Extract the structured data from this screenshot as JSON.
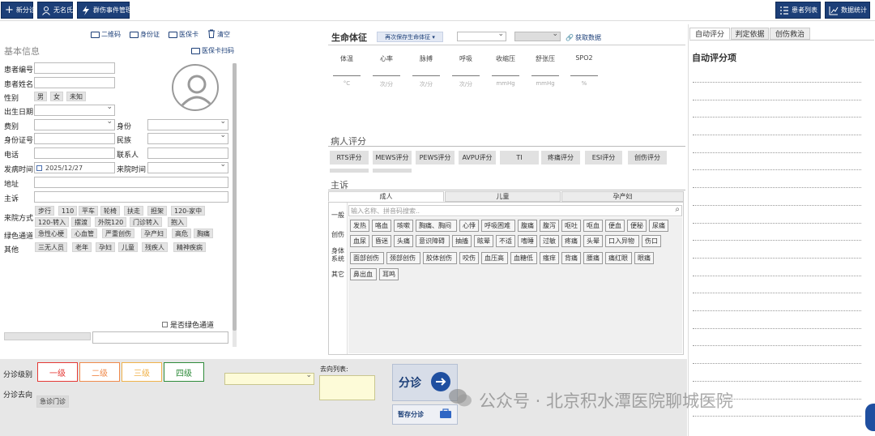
{
  "toolbar": {
    "new_triage": "新分诊",
    "anonymous": "无名氏",
    "mass_casualty": "群伤事件管理",
    "patient_list": "患者列表",
    "statistics": "数据统计"
  },
  "left": {
    "qr_code": "二维码",
    "id_card": "身份证",
    "insurance_card": "医保卡",
    "clear": "清空",
    "section_title": "基本信息",
    "insurance_scan": "医保卡扫码",
    "patient_no": "患者编号",
    "patient_name": "患者姓名",
    "gender_label": "性别",
    "gender_options": [
      "男",
      "女",
      "未知"
    ],
    "dob": "出生日期",
    "fee_type": "费别",
    "identity": "身份",
    "id_number": "身份证号",
    "ethnicity": "民族",
    "phone": "电话",
    "contact": "联系人",
    "onset_time": "发病时间",
    "onset_value": "2025/12/27",
    "arrival_time": "来院时间",
    "address": "地址",
    "complaint": "主诉",
    "arrival_mode": "来院方式",
    "arrival_options": [
      "步行",
      "110",
      "平车",
      "轮椅",
      "扶走",
      "担架",
      "120-家中",
      "120-转入",
      "摆渡",
      "外院120",
      "门诊转入",
      "抱入"
    ],
    "green_channel": "绿色通道",
    "green_options": [
      "急性心梗",
      "心血管",
      "严重创伤",
      "孕产妇",
      "高危",
      "胸痛"
    ],
    "other": "其他",
    "other_options": [
      "三无人员",
      "老年",
      "孕妇",
      "儿童",
      "残疾人",
      "精神疾病"
    ],
    "is_green_channel": "是否绿色通道"
  },
  "vitals": {
    "title": "生命体征",
    "resave": "再次保存生命体征",
    "fetch": "获取数据",
    "items": [
      {
        "label": "体温",
        "unit": "°C"
      },
      {
        "label": "心率",
        "unit": "次/分"
      },
      {
        "label": "脉搏",
        "unit": "次/分"
      },
      {
        "label": "呼吸",
        "unit": "次/分"
      },
      {
        "label": "收缩压",
        "unit": "mmHg"
      },
      {
        "label": "舒张压",
        "unit": "mmHg"
      },
      {
        "label": "SPO2",
        "unit": "%"
      }
    ]
  },
  "scores": {
    "title": "病人评分",
    "buttons": [
      "RTS评分",
      "MEWS评分",
      "PEWS评分",
      "AVPU评分",
      "TI",
      "疼痛评分",
      "ESI评分",
      "创伤评分"
    ]
  },
  "complaint": {
    "title": "主诉",
    "tabs": [
      "成人",
      "儿童",
      "孕产妇"
    ],
    "categories": [
      "一般",
      "创伤",
      "身体\n系统",
      "其它"
    ],
    "search_placeholder": "输入名称、拼音码搜索..",
    "symptoms": [
      [
        "发热",
        "咯血",
        "咳嗽",
        "胸痛、胸闷",
        "心悸",
        "呼吸困难",
        "腹痛",
        "腹泻",
        "呕吐",
        "呕血",
        "便血",
        "便秘",
        "尿痛"
      ],
      [
        "血尿",
        "昏迷",
        "头痛",
        "意识障碍",
        "抽搐",
        "眩晕",
        "不适",
        "嗜睡",
        "过敏",
        "疼痛",
        "头晕",
        "口入异物",
        "伤口"
      ],
      [
        "面部创伤",
        "颈部创伤",
        "胶体创伤",
        "咬伤",
        "血压高",
        "血糖低",
        "瘙痒",
        "背痛",
        "腰痛",
        "痛红眼",
        "眼痛"
      ],
      [
        "鼻出血",
        "耳鸣"
      ]
    ]
  },
  "right": {
    "tabs": [
      "自动评分",
      "判定依据",
      "创伤救治"
    ],
    "title": "自动评分项"
  },
  "bottom": {
    "level_label": "分诊级别",
    "levels": [
      "一级",
      "二级",
      "三级",
      "四级"
    ],
    "level_colors": [
      "#e53935",
      "#f08a4b",
      "#f0b24a",
      "#2e8b3a"
    ],
    "destination_label": "分诊去向",
    "destination_value": "急诊门诊",
    "dest_list_label": "去向列表:",
    "triage_button": "分诊",
    "save_temp": "暂存分诊"
  },
  "watermark": "公众号 · 北京积水潭医院聊城医院"
}
